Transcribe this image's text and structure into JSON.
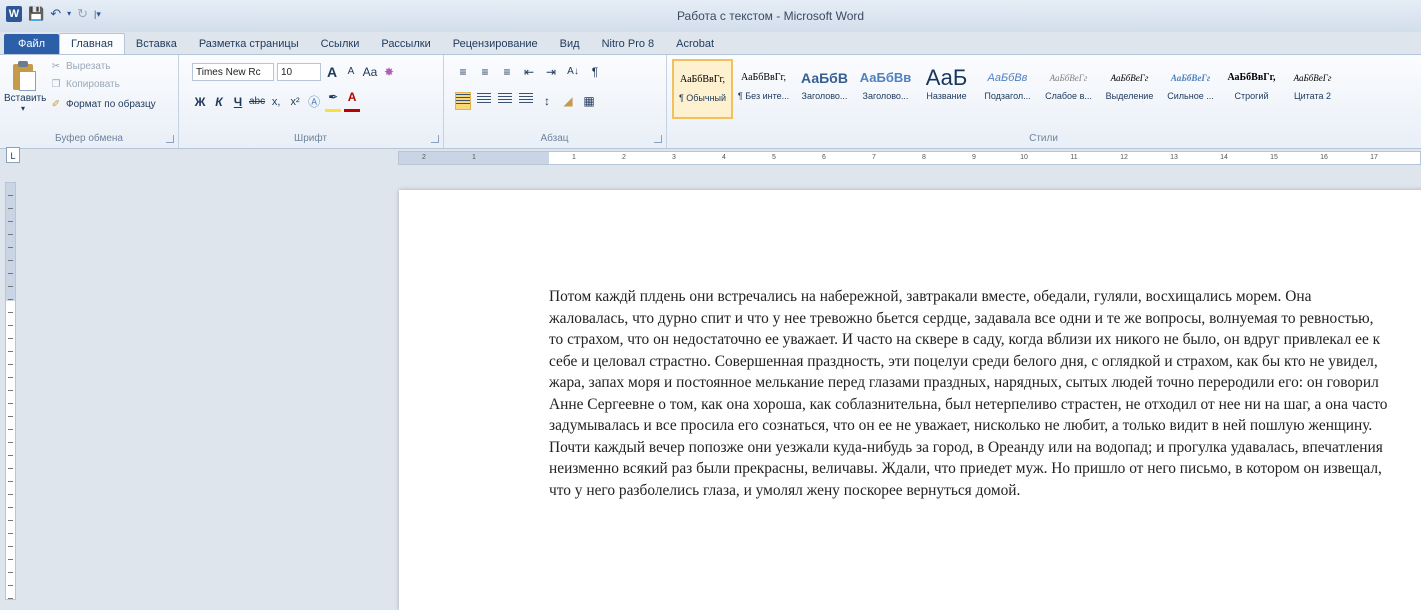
{
  "window": {
    "title": "Работа с текстом - Microsoft Word",
    "app_icon": "W"
  },
  "tabs": [
    {
      "label": "Файл",
      "kind": "file"
    },
    {
      "label": "Главная",
      "kind": "active"
    },
    {
      "label": "Вставка"
    },
    {
      "label": "Разметка страницы"
    },
    {
      "label": "Ссылки"
    },
    {
      "label": "Рассылки"
    },
    {
      "label": "Рецензирование"
    },
    {
      "label": "Вид"
    },
    {
      "label": "Nitro Pro 8"
    },
    {
      "label": "Acrobat"
    }
  ],
  "clipboard": {
    "paste": "Вставить",
    "cut": "Вырезать",
    "copy": "Копировать",
    "format_painter": "Формат по образцу",
    "group_label": "Буфер обмена"
  },
  "font": {
    "font_name": "Times New Rc",
    "font_size": "10",
    "grow": "A",
    "shrink": "A",
    "case": "Aa",
    "bold": "Ж",
    "italic": "К",
    "underline": "Ч",
    "strike": "abc",
    "subscript": "x,",
    "superscript": "x²",
    "font_color": "A",
    "group_label": "Шрифт"
  },
  "paragraph": {
    "sort": "А↓",
    "pilcrow": "¶",
    "group_label": "Абзац"
  },
  "styles": {
    "group_label": "Стили",
    "items": [
      {
        "preview": "АаБбВвГг,",
        "name": "¶ Обычный",
        "font": "Liberation Serif",
        "size": "10px",
        "color": "#000000",
        "weight": "normal",
        "style": "normal",
        "selected": true
      },
      {
        "preview": "АаБбВвГг,",
        "name": "¶ Без инте...",
        "font": "Liberation Serif",
        "size": "10px",
        "color": "#000000",
        "weight": "normal",
        "style": "normal"
      },
      {
        "preview": "АаБбВ",
        "name": "Заголово...",
        "font": "Liberation Sans",
        "size": "14px",
        "color": "#365f91",
        "weight": "bold",
        "style": "normal"
      },
      {
        "preview": "АаБбВв",
        "name": "Заголово...",
        "font": "Liberation Sans",
        "size": "13px",
        "color": "#4f81bd",
        "weight": "bold",
        "style": "normal"
      },
      {
        "preview": "АаБ",
        "name": "Название",
        "font": "Liberation Sans",
        "size": "22px",
        "color": "#17365d",
        "weight": "normal",
        "style": "normal"
      },
      {
        "preview": "АаБбВв",
        "name": "Подзагол...",
        "font": "Liberation Sans",
        "size": "11px",
        "color": "#4f81bd",
        "weight": "normal",
        "style": "italic"
      },
      {
        "preview": "АаБбВеГг",
        "name": "Слабое в...",
        "font": "Liberation Serif",
        "size": "9px",
        "color": "#808080",
        "weight": "normal",
        "style": "italic"
      },
      {
        "preview": "АаБбВеГг",
        "name": "Выделение",
        "font": "Liberation Serif",
        "size": "9px",
        "color": "#000000",
        "weight": "normal",
        "style": "italic"
      },
      {
        "preview": "АаБбВеГг",
        "name": "Сильное ...",
        "font": "Liberation Serif",
        "size": "9px",
        "color": "#4f81bd",
        "weight": "bold",
        "style": "italic"
      },
      {
        "preview": "АаБбВвГг,",
        "name": "Строгий",
        "font": "Liberation Serif",
        "size": "10px",
        "color": "#000000",
        "weight": "bold",
        "style": "normal"
      },
      {
        "preview": "АаБбВеГг",
        "name": "Цитата 2",
        "font": "Liberation Serif",
        "size": "9px",
        "color": "#000000",
        "weight": "normal",
        "style": "italic"
      }
    ]
  },
  "ruler": {
    "tab_selector": "L",
    "marks": [
      "2",
      "1",
      "",
      "1",
      "2",
      "3",
      "4",
      "5",
      "6",
      "7",
      "8",
      "9",
      "10",
      "11",
      "12",
      "13",
      "14",
      "15",
      "16",
      "17"
    ]
  },
  "document": {
    "paragraph": "Потом каждй плдень они встречались на набережной, завтракали вместе, обедали, гуляли, восхищались морем. Она жаловалась, что дурно спит и что у нее тревожно бьется сердце, задавала все одни и те же вопросы, волнуемая то ревностью, то страхом, что он недостаточно ее уважает. И часто на сквере в саду, когда вблизи их никого не было, он вдруг привлекал ее к себе и целовал страстно. Совершенная праздность, эти поцелуи среди белого дня, с оглядкой и страхом, как бы кто не увидел, жара, запах моря и постоянное мелькание перед глазами праздных, нарядных, сытых людей точно переродили его: он говорил Анне Сергеевне о том, как она хороша, как соблазнительна, был нетерпеливо страстен, не отходил от нее ни на шаг, а она часто задумывалась и все просила его сознаться, что он ее не уважает, нисколько не любит, а только видит в ней пошлую женщину. Почти каждый вечер попозже они уезжали куда-нибудь за город, в Ореанду или на водопад; и прогулка удавалась, впечатления неизменно всякий раз были прекрасны, величавы. Ждали, что приедет муж. Но пришло от него письмо, в котором он извещал, что у него разболелись глаза, и умолял жену поскорее вернуться домой."
  }
}
